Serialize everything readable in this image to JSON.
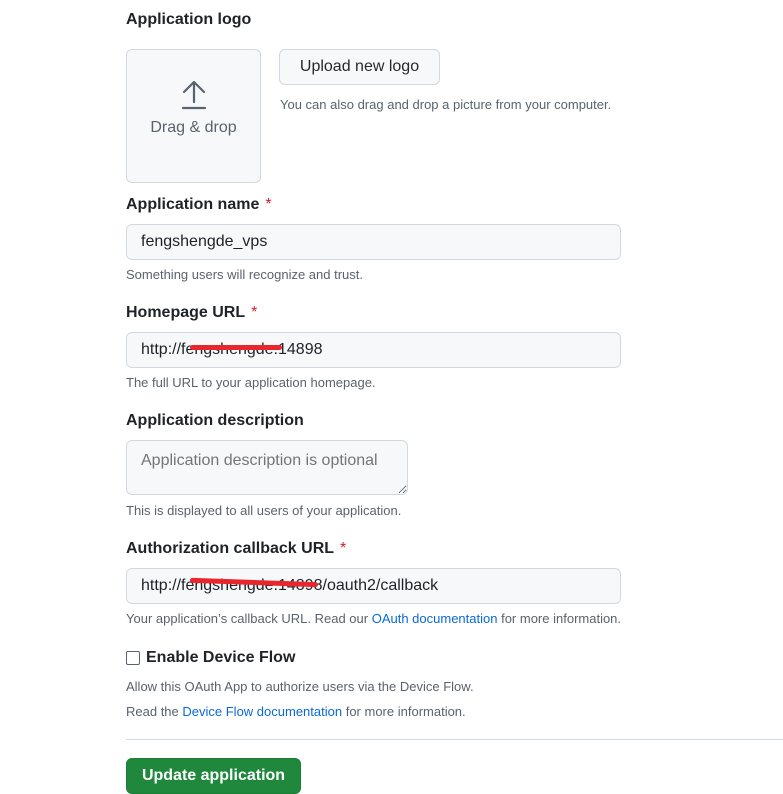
{
  "logo": {
    "heading": "Application logo",
    "dropzone_label": "Drag & drop",
    "upload_button": "Upload new logo",
    "upload_hint": "You can also drag and drop a picture from your computer."
  },
  "app_name": {
    "label": "Application name",
    "required_mark": "*",
    "value": "fengshengde_vps",
    "hint": "Something users will recognize and trust."
  },
  "homepage": {
    "label": "Homepage URL",
    "required_mark": "*",
    "value": "http://fengshengde:14898",
    "hint": "The full URL to your application homepage."
  },
  "description": {
    "label": "Application description",
    "placeholder": "Application description is optional",
    "hint": "This is displayed to all users of your application."
  },
  "callback": {
    "label": "Authorization callback URL",
    "required_mark": "*",
    "value": "http://fengshengde:14898/oauth2/callback",
    "hint_before": "Your application’s callback URL. Read our",
    "hint_link": "OAuth documentation",
    "hint_after": "for more information."
  },
  "device_flow": {
    "checkbox_label": "Enable Device Flow",
    "checked": false,
    "hint_line1": "Allow this OAuth App to authorize users via the Device Flow.",
    "hint_before": "Read the",
    "hint_link": "Device Flow documentation",
    "hint_after": "for more information."
  },
  "submit_button": "Update application",
  "colors": {
    "primary_button": "#1f883d",
    "link": "#0969da",
    "required": "#cf222e",
    "redaction": "#e8262b"
  }
}
